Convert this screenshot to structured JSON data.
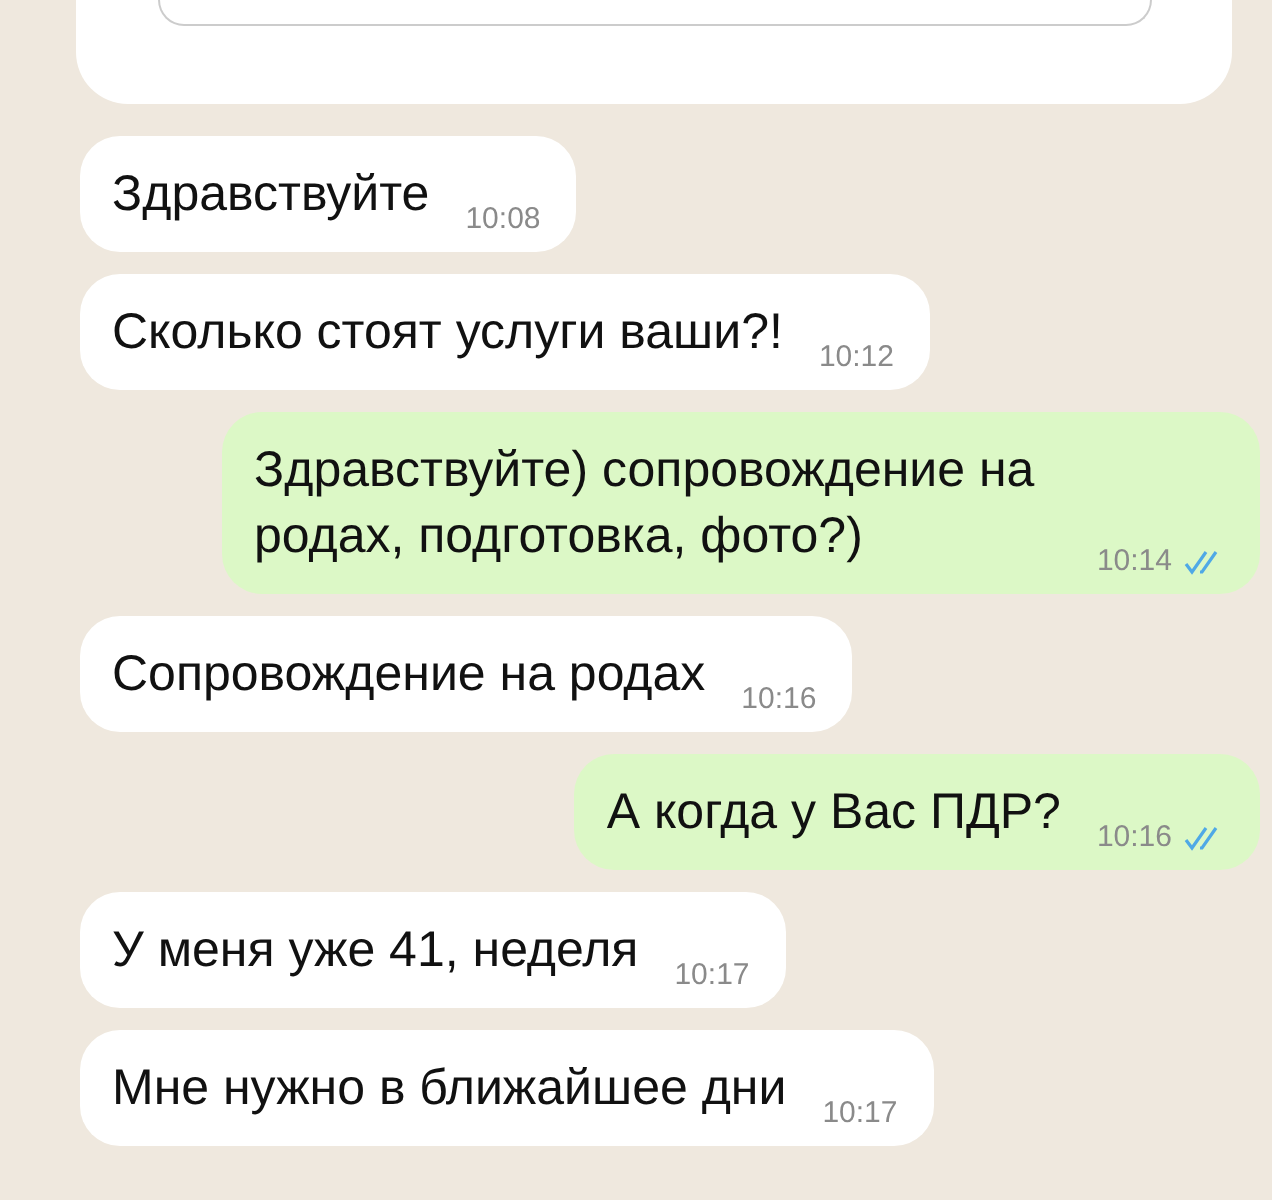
{
  "messages": [
    {
      "kind": "in",
      "text": "Здравствуйте",
      "time": "10:08"
    },
    {
      "kind": "in",
      "text": "Сколько стоят услуги ваши?!",
      "time": "10:12"
    },
    {
      "kind": "out",
      "text": "Здравствуйте) сопровождение на родах, подготовка, фото?)",
      "time": "10:14",
      "read": true
    },
    {
      "kind": "in",
      "text": "Сопровождение на родах",
      "time": "10:16"
    },
    {
      "kind": "out",
      "text": "А когда у Вас ПДР?",
      "time": "10:16",
      "read": true
    },
    {
      "kind": "in",
      "text": "У меня уже 41, неделя",
      "time": "10:17"
    },
    {
      "kind": "in",
      "text": "Мне нужно в ближайшее дни",
      "time": "10:17"
    }
  ]
}
